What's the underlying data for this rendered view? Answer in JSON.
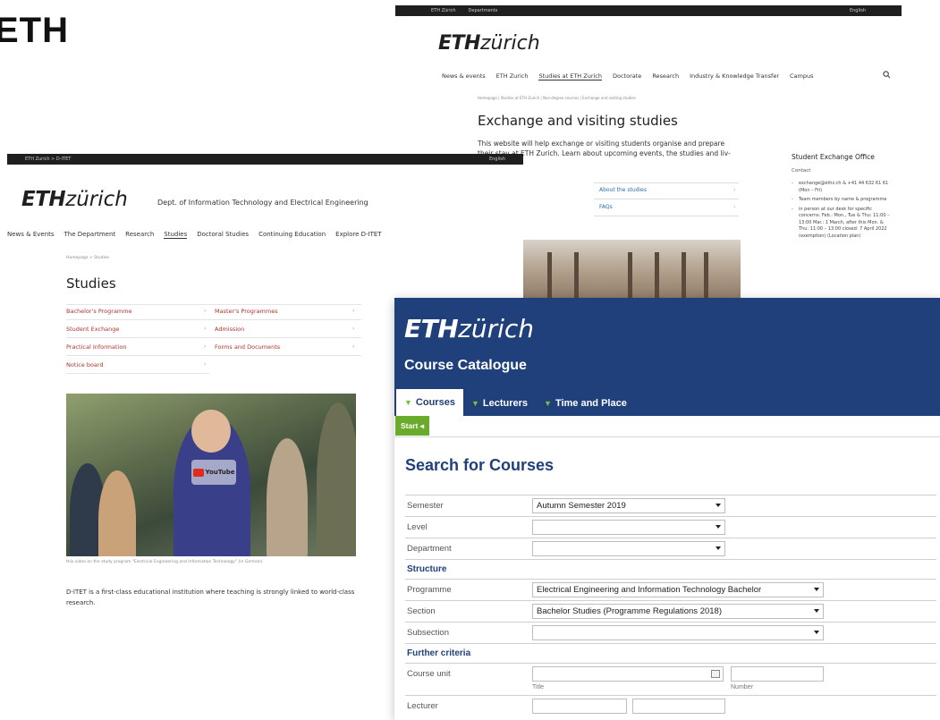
{
  "big_text": "ETH",
  "shotA": {
    "topbar": {
      "home": "ETH Zürich",
      "departments": "Departments",
      "lang": "English"
    },
    "logo": {
      "eth": "ETH",
      "zurich": "zürich"
    },
    "nav": [
      "News & events",
      "ETH Zurich",
      "Studies at ETH Zurich",
      "Doctorate",
      "Research",
      "Industry & Knowledge Transfer",
      "Campus"
    ],
    "breadcrumb": "Homepage | Studies at ETH Zurich | Non-degree courses | Exchange and visiting studies",
    "title": "Exchange and visiting studies",
    "intro": "This website will help exchange or visiting students organise and prepare their stay at ETH Zurich. Learn about upcoming events, the studies and liv-",
    "links": [
      "About the studies",
      "FAQs"
    ],
    "sidebar": {
      "heading": "Student Exchange Office",
      "contact": "Contact",
      "items": [
        "exchange@ethz.ch & +41 44 632 61 61 (Mon – Fri)",
        "Team members by name & programme",
        "in person at our desk for specific concerns: Feb.: Mon., Tue & Thu: 11:00 – 13:00  Mar.: 1 March, after this Mon. & Thu: 11:00 – 13:00  closed: 7 April 2022 (exemption) (Location plan)"
      ]
    }
  },
  "shotB": {
    "topbar": {
      "crumb": "ETH Zurich  >  D-ITET",
      "lang": "English"
    },
    "logo": {
      "eth": "ETH",
      "zurich": "zürich"
    },
    "dept": "Dept. of Information Technology and Electrical Engineering",
    "nav": [
      "News & Events",
      "The Department",
      "Research",
      "Studies",
      "Doctoral Studies",
      "Continuing Education",
      "Explore D-ITET"
    ],
    "breadcrumb": "Homepage  >  Studies",
    "title": "Studies",
    "links_left": [
      "Bachelor's Programme",
      "Student Exchange",
      "Practical Information",
      "Notice board"
    ],
    "links_right": [
      "Master's Programmes",
      "Admission",
      "Forms and Documents"
    ],
    "video": {
      "yt_label": "YouTube"
    },
    "caption": "this video on the study program \"Electrical Engineering and Information Technology\" (in German)",
    "body": "D-ITET is a first-class educational institution where teaching is strongly linked to world-class research."
  },
  "shotC": {
    "logo": {
      "eth": "ETH",
      "zurich": "zürich"
    },
    "app_name": "Course Catalogue",
    "tabs": [
      "Courses",
      "Lecturers",
      "Time and Place"
    ],
    "start_button": "Start",
    "page_title": "Search for Courses",
    "fields": {
      "semester": {
        "label": "Semester",
        "value": "Autumn Semester 2019"
      },
      "level": {
        "label": "Level",
        "value": ""
      },
      "department": {
        "label": "Department",
        "value": ""
      },
      "structure_heading": "Structure",
      "programme": {
        "label": "Programme",
        "value": "Electrical Engineering and Information Technology Bachelor"
      },
      "section": {
        "label": "Section",
        "value": "Bachelor Studies (Programme Regulations 2018)"
      },
      "subsection": {
        "label": "Subsection",
        "value": ""
      },
      "further_heading": "Further criteria",
      "course_unit": {
        "label": "Course unit",
        "title_hint": "Title",
        "number_hint": "Number"
      },
      "lecturer": {
        "label": "Lecturer"
      }
    },
    "colors": {
      "primary": "#1f407a",
      "accent_green": "#6aab2e",
      "link_red": "#b2332b"
    }
  }
}
